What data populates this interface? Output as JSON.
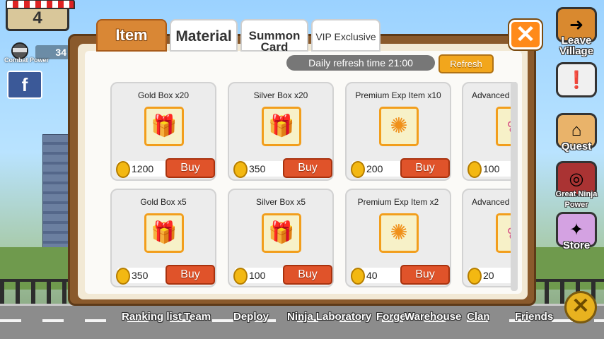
{
  "hud": {
    "level": "4",
    "power_label": "Combat Power",
    "power_value": "34"
  },
  "side_menu": {
    "leave_village": "Leave Village",
    "quest": "Quest",
    "great_ninja": "Great Ninja Power",
    "store": "Store"
  },
  "bottom_nav": [
    "Ranking list",
    "Team",
    "Deploy",
    "Ninja Laboratory",
    "Forge",
    "Warehouse",
    "Clan",
    "Friends"
  ],
  "dialog": {
    "tabs": [
      "Item",
      "Material",
      "Summon Card",
      "VIP Exclusive"
    ],
    "active_tab": "Item",
    "refresh_info": "Daily refresh time 21:00",
    "refresh_button": "Refresh",
    "buy_label": "Buy",
    "items": [
      {
        "name": "Gold Box x20",
        "price": "1200",
        "icon": "gold-chest-icon"
      },
      {
        "name": "Silver Box x20",
        "price": "350",
        "icon": "silver-chest-icon"
      },
      {
        "name": "Premium Exp Item x10",
        "price": "200",
        "icon": "exp-scroll-icon"
      },
      {
        "name": "Advanced",
        "price": "100",
        "icon": "advanced-item-icon"
      },
      {
        "name": "Gold Box x5",
        "price": "350",
        "icon": "gold-chest-icon"
      },
      {
        "name": "Silver Box x5",
        "price": "100",
        "icon": "silver-chest-icon"
      },
      {
        "name": "Premium Exp Item x2",
        "price": "40",
        "icon": "exp-scroll-icon"
      },
      {
        "name": "Advanced",
        "price": "20",
        "icon": "advanced-item-icon"
      }
    ]
  },
  "colors": {
    "accent_orange": "#d98735",
    "buy_red": "#e0532a",
    "coin_gold": "#f3b812",
    "frame_brown": "#8a5a2c"
  }
}
